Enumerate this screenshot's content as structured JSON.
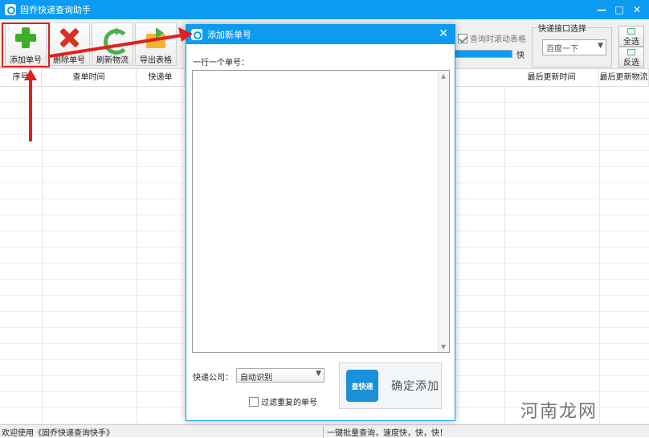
{
  "window": {
    "title": "固乔快递查询助手",
    "controls": [
      "—",
      "□",
      "✕"
    ]
  },
  "toolbar": {
    "buttons": [
      {
        "label": "添加单号",
        "icon": "add-icon"
      },
      {
        "label": "删除单号",
        "icon": "delete-icon"
      },
      {
        "label": "刷新物流",
        "icon": "refresh-icon"
      },
      {
        "label": "导出表格",
        "icon": "export-icon"
      }
    ],
    "scroll_checkbox": {
      "label": "查询时滚动表格",
      "checked": true
    },
    "progress": {
      "percent": 100,
      "speed_label": "快"
    },
    "api_group": {
      "title": "快递接口选择",
      "selected": "百度一下"
    },
    "select_all": "全选",
    "invert_select": "反选"
  },
  "table": {
    "columns": [
      "序号",
      "查单时间",
      "快递单",
      "最后更新时间",
      "最后更新物流"
    ]
  },
  "status": {
    "left": "欢迎使用《固乔快递查询快手》",
    "right": "一键批量查询，速度快，快，快！"
  },
  "watermark": "河南龙网",
  "dialog": {
    "title": "添加新单号",
    "close": "✕",
    "prompt": "一行一个单号：",
    "textarea_value": "",
    "company_label": "快递公司：",
    "company_selected": "自动识别",
    "dedupe_label": "过滤重复的单号",
    "dedupe_checked": false,
    "confirm_label": "确定添加",
    "logo_text": "查快递"
  },
  "colors": {
    "titlebar": "#0c9bf1",
    "annotation": "#e02020"
  }
}
